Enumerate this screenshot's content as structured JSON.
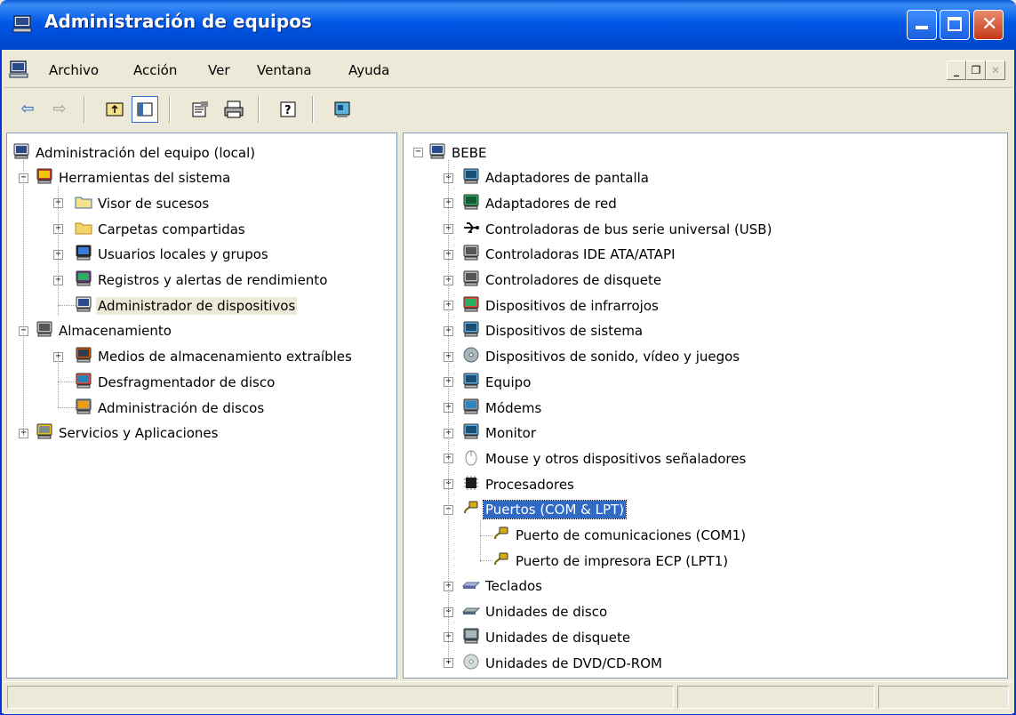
{
  "window": {
    "title": "Administración de equipos"
  },
  "menu": {
    "items": [
      "Archivo",
      "Acción",
      "Ver",
      "Ventana",
      "Ayuda"
    ]
  },
  "mdi_buttons": [
    "_",
    "❐",
    "✕"
  ],
  "left_tree": {
    "nodes": [
      {
        "label": "Administración del equipo (local)",
        "icon": "computer-icon",
        "level": 0,
        "expander": "none"
      },
      {
        "label": "Herramientas del sistema",
        "icon": "tools-icon",
        "level": 1,
        "expander": "minus"
      },
      {
        "label": "Visor de sucesos",
        "icon": "event-viewer-icon",
        "level": 2,
        "expander": "plus"
      },
      {
        "label": "Carpetas compartidas",
        "icon": "shared-folder-icon",
        "level": 2,
        "expander": "plus"
      },
      {
        "label": "Usuarios locales y grupos",
        "icon": "users-icon",
        "level": 2,
        "expander": "plus"
      },
      {
        "label": "Registros y alertas de rendimiento",
        "icon": "performance-icon",
        "level": 2,
        "expander": "plus"
      },
      {
        "label": "Administrador de dispositivos",
        "icon": "device-manager-icon",
        "level": 2,
        "expander": "none",
        "selected": true
      },
      {
        "label": "Almacenamiento",
        "icon": "storage-icon",
        "level": 1,
        "expander": "minus"
      },
      {
        "label": "Medios de almacenamiento extraíbles",
        "icon": "removable-storage-icon",
        "level": 2,
        "expander": "plus"
      },
      {
        "label": "Desfragmentador de disco",
        "icon": "defrag-icon",
        "level": 2,
        "expander": "none"
      },
      {
        "label": "Administración de discos",
        "icon": "disk-management-icon",
        "level": 2,
        "expander": "none"
      },
      {
        "label": "Servicios y Aplicaciones",
        "icon": "services-icon",
        "level": 1,
        "expander": "plus"
      }
    ]
  },
  "right_tree": {
    "root": {
      "label": "BEBE",
      "icon": "computer-icon"
    },
    "nodes": [
      {
        "label": "Adaptadores de pantalla",
        "icon": "display-adapter-icon",
        "expander": "plus"
      },
      {
        "label": "Adaptadores de red",
        "icon": "network-adapter-icon",
        "expander": "plus"
      },
      {
        "label": "Controladoras de bus serie universal (USB)",
        "icon": "usb-icon",
        "expander": "plus"
      },
      {
        "label": "Controladoras IDE ATA/ATAPI",
        "icon": "ide-controller-icon",
        "expander": "plus"
      },
      {
        "label": "Controladores de disquete",
        "icon": "floppy-controller-icon",
        "expander": "plus"
      },
      {
        "label": "Dispositivos de infrarrojos",
        "icon": "infrared-icon",
        "expander": "plus"
      },
      {
        "label": "Dispositivos de sistema",
        "icon": "system-device-icon",
        "expander": "plus"
      },
      {
        "label": "Dispositivos de sonido, vídeo y juegos",
        "icon": "sound-icon",
        "expander": "plus"
      },
      {
        "label": "Equipo",
        "icon": "computer-device-icon",
        "expander": "plus"
      },
      {
        "label": "Módems",
        "icon": "modem-icon",
        "expander": "plus"
      },
      {
        "label": "Monitor",
        "icon": "monitor-icon",
        "expander": "plus"
      },
      {
        "label": "Mouse y otros dispositivos señaladores",
        "icon": "mouse-icon",
        "expander": "plus"
      },
      {
        "label": "Procesadores",
        "icon": "processor-icon",
        "expander": "plus"
      },
      {
        "label": "Puertos (COM & LPT)",
        "icon": "port-icon",
        "expander": "minus",
        "highlighted": true,
        "children": [
          {
            "label": "Puerto de comunicaciones (COM1)",
            "icon": "port-icon"
          },
          {
            "label": "Puerto de impresora ECP (LPT1)",
            "icon": "port-icon"
          }
        ]
      },
      {
        "label": "Teclados",
        "icon": "keyboard-icon",
        "expander": "plus"
      },
      {
        "label": "Unidades de disco",
        "icon": "disk-drive-icon",
        "expander": "plus"
      },
      {
        "label": "Unidades de disquete",
        "icon": "floppy-drive-icon",
        "expander": "plus"
      },
      {
        "label": "Unidades de DVD/CD-ROM",
        "icon": "cdrom-icon",
        "expander": "plus"
      }
    ]
  },
  "colors": {
    "titlebar": "#0058e6",
    "selection": "#316ac5",
    "chrome": "#ece9d8"
  }
}
